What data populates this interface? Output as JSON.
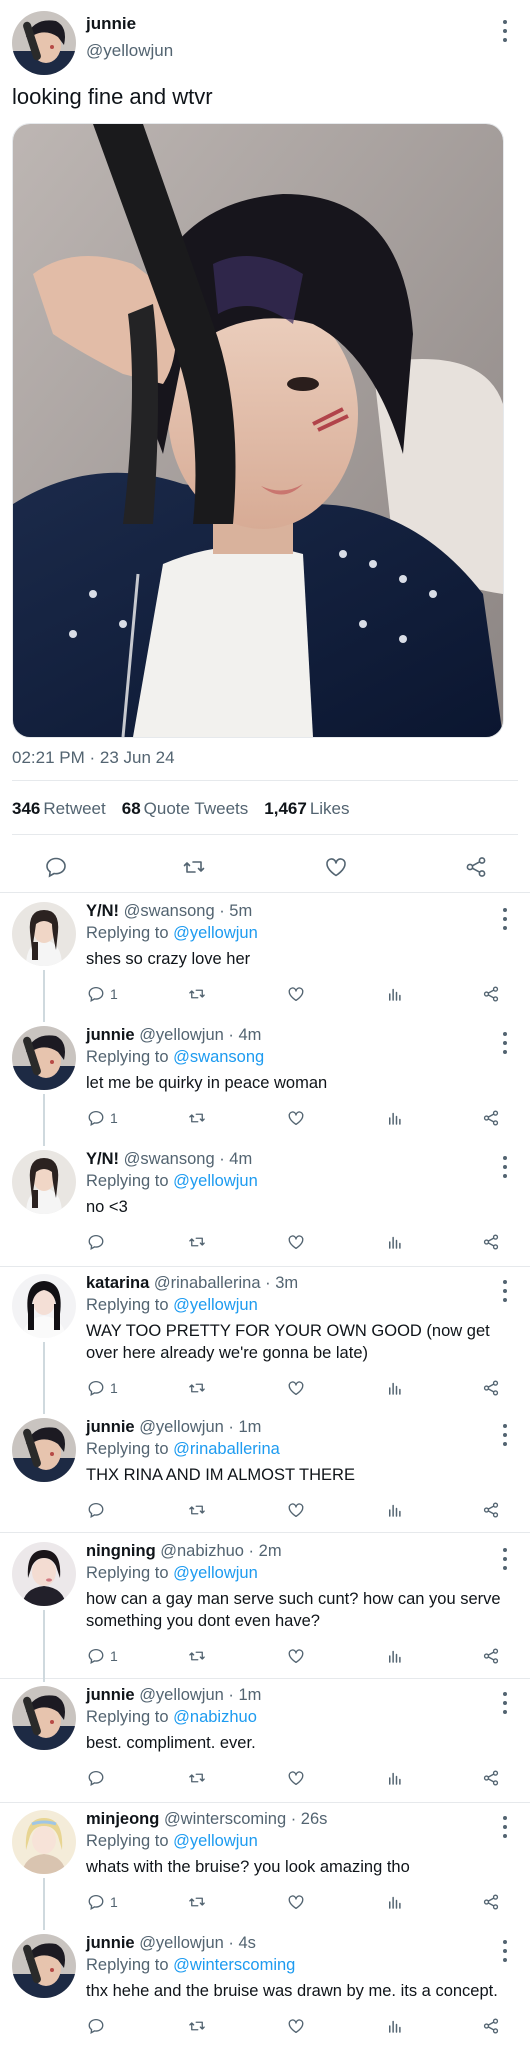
{
  "colors": {
    "text_primary": "#0f1419",
    "text_secondary": "#536471",
    "mention": "#1d9bf0",
    "divider": "#e6e9ec",
    "thread_line": "#cfd9de"
  },
  "main_tweet": {
    "author_name": "junnie",
    "author_handle": "@yellowjun",
    "text": "looking fine and wtvr",
    "timestamp": "02:21 PM · 23 Jun 24",
    "stats": {
      "retweets_count": "346",
      "retweets_label": "Retweet",
      "quotes_count": "68",
      "quotes_label": "Quote Tweets",
      "likes_count": "1,467",
      "likes_label": "Likes"
    },
    "actions": [
      "reply-icon",
      "retweet-icon",
      "like-icon",
      "share-icon"
    ]
  },
  "replies": [
    {
      "name": "Y/N!",
      "meta": "@swansong · 5m",
      "replying_label": "Replying to",
      "replying_to": "@yellowjun",
      "text": "shes so crazy love her",
      "reply_count": "1",
      "avatar": "photo-girl-dark-hair"
    },
    {
      "name": "junnie",
      "meta": "@yellowjun · 4m",
      "replying_label": "Replying to",
      "replying_to": "@swansong",
      "text": "let me be quirky in peace woman",
      "reply_count": "1",
      "avatar": "photo-junnie"
    },
    {
      "name": "Y/N!",
      "meta": "@swansong · 4m",
      "replying_label": "Replying to",
      "replying_to": "@yellowjun",
      "text": "no <3",
      "reply_count": "",
      "avatar": "photo-girl-dark-hair"
    },
    {
      "name": "katarina",
      "meta": "@rinaballerina · 3m",
      "replying_label": "Replying to",
      "replying_to": "@yellowjun",
      "text": "WAY TOO PRETTY FOR YOUR OWN GOOD (now get over here already we're gonna be late)",
      "reply_count": "1",
      "avatar": "photo-katarina"
    },
    {
      "name": "junnie",
      "meta": "@yellowjun · 1m",
      "replying_label": "Replying to",
      "replying_to": "@rinaballerina",
      "text": "THX RINA AND IM ALMOST THERE",
      "reply_count": "",
      "avatar": "photo-junnie"
    },
    {
      "name": "ningning",
      "meta": "@nabizhuo · 2m",
      "replying_label": "Replying to",
      "replying_to": "@yellowjun",
      "text": "how can a gay man serve such cunt? how can you serve something you dont even have?",
      "reply_count": "1",
      "avatar": "photo-ningning"
    },
    {
      "name": "junnie",
      "meta": "@yellowjun · 1m",
      "replying_label": "Replying to",
      "replying_to": "@nabizhuo",
      "text": "best. compliment. ever.",
      "reply_count": "",
      "avatar": "photo-junnie"
    },
    {
      "name": "minjeong",
      "meta": "@winterscoming · 26s",
      "replying_label": "Replying to",
      "replying_to": "@yellowjun",
      "text": "whats with the bruise? you look amazing tho",
      "reply_count": "1",
      "avatar": "photo-minjeong"
    },
    {
      "name": "junnie",
      "meta": "@yellowjun · 4s",
      "replying_label": "Replying to",
      "replying_to": "@winterscoming",
      "text": "thx hehe and the bruise was drawn by me. its a concept.",
      "reply_count": "",
      "avatar": "photo-junnie"
    }
  ]
}
